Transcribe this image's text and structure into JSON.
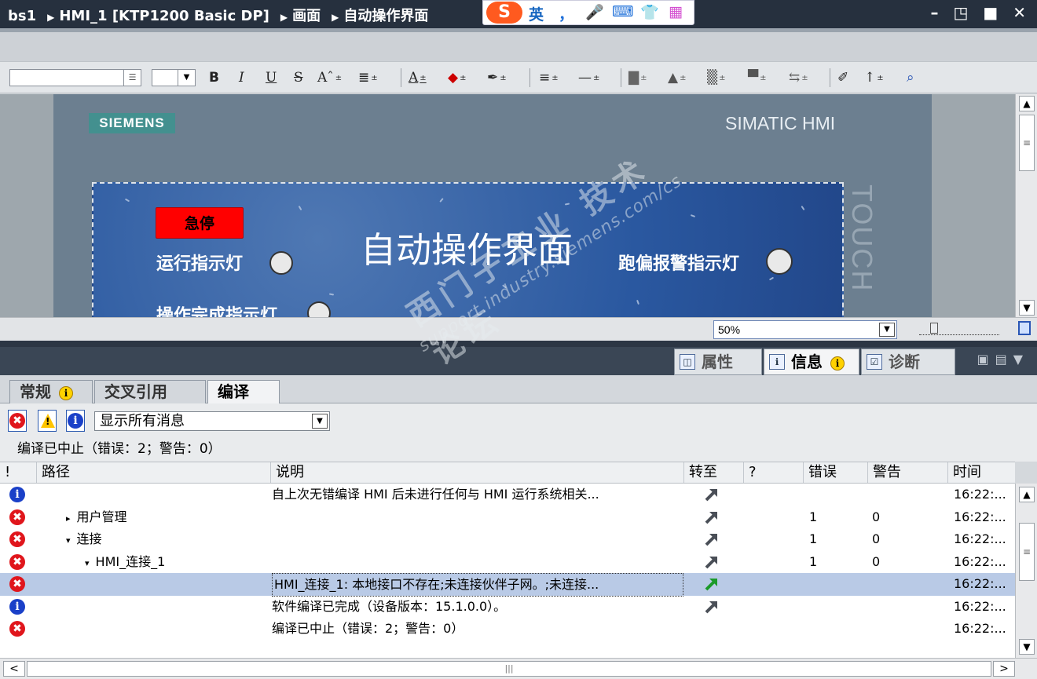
{
  "titlebar": {
    "crumbs": [
      "bs1",
      "HMI_1 [KTP1200 Basic DP]",
      "画面",
      "自动操作界面"
    ],
    "ime": {
      "logo": "S",
      "lang": "英",
      "punct": "，",
      "voice": "mic-icon",
      "keyboard": "keyboard-icon",
      "skin": "shirt-icon",
      "apps": "apps-icon"
    },
    "window_controls": "– ◳ ■ ✕"
  },
  "toolbar": {
    "font_name": "",
    "font_size": "",
    "bold": "B",
    "italic": "I",
    "underline": "U",
    "strike": "S",
    "superscript": "Aˆ",
    "align": "≣",
    "font_color": "A",
    "fill": "◆",
    "pen": "✒",
    "line_style": "≡",
    "line_width": "—",
    "arrange": "▇",
    "rotate": "▲",
    "align_objs": "▒",
    "distribute": "▀",
    "spacing": "⇆",
    "brush": "✐",
    "tab_order": "↑",
    "zoom_region": "⌕"
  },
  "editor": {
    "brand": "SIEMENS",
    "model": "SIMATIC HMI",
    "touch": "TOUCH",
    "screen": {
      "title": "自动操作界面",
      "estop": "急停",
      "lamp_run": "运行指示灯",
      "lamp_done": "操作完成指示灯",
      "lamp_deviation": "跑偏报警指示灯"
    },
    "zoom": "50%"
  },
  "inspector": {
    "tabs": [
      {
        "label": "属性",
        "icon": "properties-icon",
        "badge": ""
      },
      {
        "label": "信息",
        "icon": "info-icon",
        "badge": "i"
      },
      {
        "label": "诊断",
        "icon": "diagnostics-icon",
        "badge": ""
      }
    ],
    "subtabs": [
      {
        "label": "常规",
        "badge": "i"
      },
      {
        "label": "交叉引用",
        "badge": ""
      },
      {
        "label": "编译",
        "badge": ""
      }
    ],
    "filter": {
      "selected": "显示所有消息"
    },
    "status": "编译已中止（错误：2；警告：0）",
    "columns": [
      "!",
      "路径",
      "说明",
      "转至",
      "?",
      "错误",
      "警告",
      "时间"
    ],
    "rows": [
      {
        "type": "info",
        "path": "",
        "depth": 0,
        "caret": "",
        "desc": "自上次无错编译 HMI 后未进行任何与 HMI 运行系统相关...",
        "goto": true,
        "errors": "",
        "warnings": "",
        "time": "16:22:..."
      },
      {
        "type": "error",
        "path": "用户管理",
        "depth": 1,
        "caret": "▸",
        "desc": "",
        "goto": true,
        "errors": "1",
        "warnings": "0",
        "time": "16:22:..."
      },
      {
        "type": "error",
        "path": "连接",
        "depth": 1,
        "caret": "▾",
        "desc": "",
        "goto": true,
        "errors": "1",
        "warnings": "0",
        "time": "16:22:..."
      },
      {
        "type": "error",
        "path": "HMI_连接_1",
        "depth": 2,
        "caret": "▾",
        "desc": "",
        "goto": true,
        "errors": "1",
        "warnings": "0",
        "time": "16:22:..."
      },
      {
        "type": "error",
        "path": "",
        "depth": 0,
        "caret": "",
        "desc": "HMI_连接_1: 本地接口不存在;未连接伙伴子网。;未连接...",
        "goto": true,
        "errors": "",
        "warnings": "",
        "time": "16:22:...",
        "selected": true
      },
      {
        "type": "info",
        "path": "",
        "depth": 0,
        "caret": "",
        "desc": "软件编译已完成（设备版本：15.1.0.0）。",
        "goto": true,
        "errors": "",
        "warnings": "",
        "time": "16:22:..."
      },
      {
        "type": "error",
        "path": "",
        "depth": 0,
        "caret": "",
        "desc": "编译已中止（错误：2；警告：0）",
        "goto": false,
        "errors": "",
        "warnings": "",
        "time": "16:22:..."
      }
    ]
  },
  "watermark": {
    "cn": "西门子工业 技术论坛",
    "url": "support.industry.siemens.com/cs"
  },
  "colors": {
    "error": "#e0161c",
    "info": "#1a40c8",
    "selected_row": "#b9cae6",
    "estop": "#ff0000",
    "brand": "#43908f"
  }
}
